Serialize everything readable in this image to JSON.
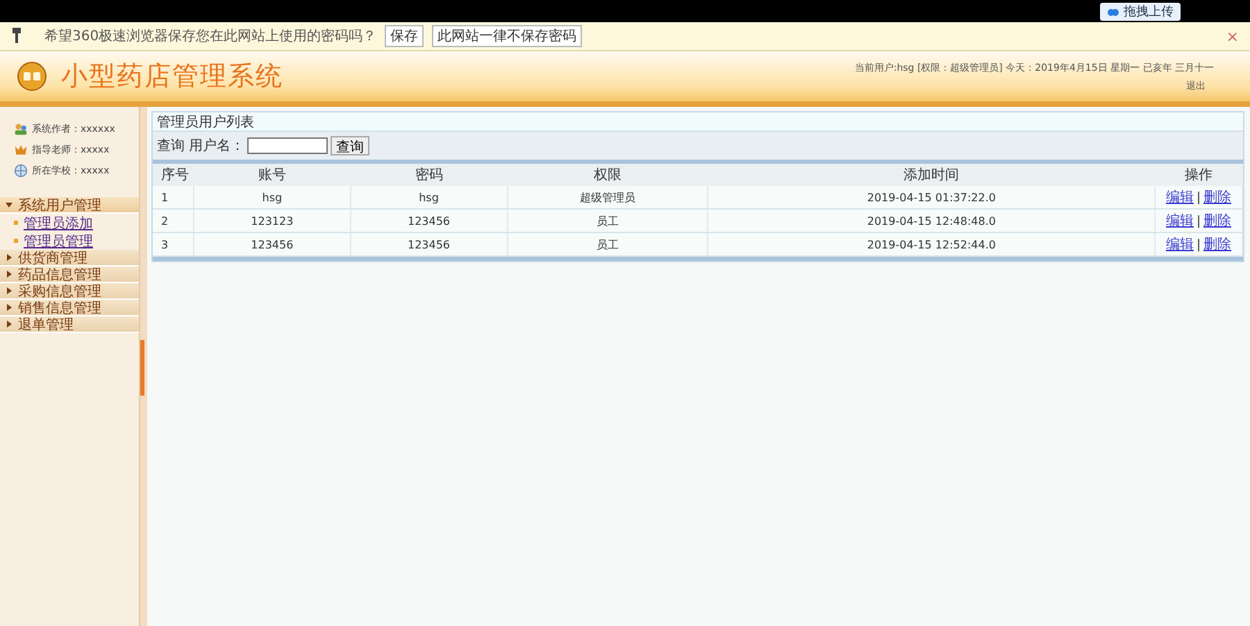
{
  "top_bar": {
    "upload_button": "拖拽上传"
  },
  "password_bar": {
    "message": "希望360极速浏览器保存您在此网站上使用的密码吗？",
    "buttons": [
      "保存",
      "此网站一律不保存密码"
    ],
    "close": "×"
  },
  "header": {
    "title": "小型药店管理系统",
    "status": "当前用户:hsg [权限：超级管理员] 今天：2019年4月15日 星期一 已亥年 三月十一",
    "logout": "退出"
  },
  "sidebar": {
    "info": [
      {
        "kind": "author",
        "text": "系统作者：xxxxxx"
      },
      {
        "kind": "teacher",
        "text": "指导老师：xxxxx"
      },
      {
        "kind": "school",
        "text": "所在学校：xxxxx"
      }
    ],
    "menu": [
      {
        "label": "系统用户管理",
        "expanded": true,
        "children": [
          {
            "label": "管理员添加"
          },
          {
            "label": "管理员管理"
          }
        ]
      },
      {
        "label": "供货商管理",
        "expanded": false
      },
      {
        "label": "药品信息管理",
        "expanded": false
      },
      {
        "label": "采购信息管理",
        "expanded": false
      },
      {
        "label": "销售信息管理",
        "expanded": false
      },
      {
        "label": "退单管理",
        "expanded": false
      }
    ]
  },
  "panel": {
    "title": "管理员用户列表",
    "search_label": "查询 用户名：",
    "search_button": "查询"
  },
  "table": {
    "columns": [
      "序号",
      "账号",
      "密码",
      "权限",
      "添加时间",
      "操作"
    ],
    "action_separator": "|",
    "rows": [
      {
        "cells": [
          "1",
          "hsg",
          "hsg",
          "超级管理员",
          "2019-04-15 01:37:22.0"
        ],
        "actions": [
          "编辑",
          "删除"
        ]
      },
      {
        "cells": [
          "2",
          "123123",
          "123456",
          "员工",
          "2019-04-15 12:48:48.0"
        ],
        "actions": [
          "编辑",
          "删除"
        ]
      },
      {
        "cells": [
          "3",
          "123456",
          "123456",
          "员工",
          "2019-04-15 12:52:44.0"
        ],
        "actions": [
          "编辑",
          "删除"
        ]
      }
    ]
  }
}
